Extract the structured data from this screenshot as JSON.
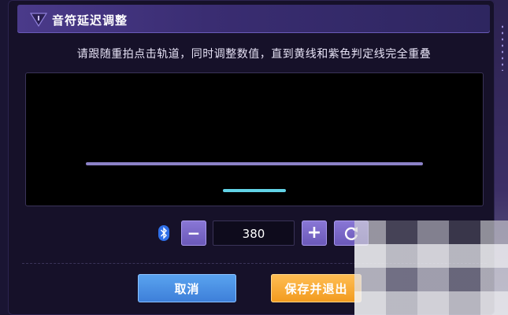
{
  "dialog": {
    "title": "音符延迟调整",
    "instructions": "请跟随重拍点击轨道，同时调整数值，直到黄线和紫色判定线完全重叠"
  },
  "controls": {
    "value": "380",
    "minus_symbol": "−",
    "plus_symbol": "+"
  },
  "buttons": {
    "cancel": "取消",
    "save": "保存并退出"
  },
  "colors": {
    "judgement_line": "#8c82c8",
    "note_line": "#62d3e6",
    "cancel_button": "#4a8ee6",
    "save_button": "#f5a62e",
    "title_bar": "#3f3180"
  }
}
